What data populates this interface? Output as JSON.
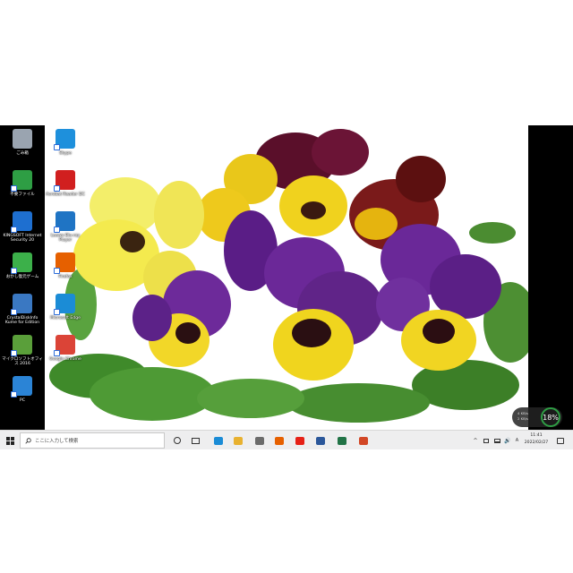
{
  "desktop_icons": [
    {
      "label": "ごみ箱",
      "icon": "recycle-bin-icon",
      "color": "#9aa4b0"
    },
    {
      "label": "不要ファイル",
      "icon": "recycle-green-icon",
      "color": "#2e9e44"
    },
    {
      "label": "KINGSOFT Internet Security 20",
      "icon": "kingsoft-security-icon",
      "color": "#1e6fd0"
    },
    {
      "label": "おかし復元ゲーム",
      "icon": "eye-green-icon",
      "color": "#3cb04a"
    },
    {
      "label": "CrystalDiskInfo Kume for Edition",
      "icon": "crystaldiskinfo-icon",
      "color": "#3a78c2"
    },
    {
      "label": "マイクロソフトオフィス 2016",
      "icon": "office-setup-icon",
      "color": "#5a9f3a"
    },
    {
      "label": "PC",
      "icon": "pc-monitor-icon",
      "color": "#2b84d6"
    },
    {
      "label": "Skype",
      "icon": "skype-icon",
      "color": "#1e90dc"
    },
    {
      "label": "Acrobat Reader DC",
      "icon": "acrobat-reader-icon",
      "color": "#d11f1f"
    },
    {
      "label": "Leawo Blu-ray Player",
      "icon": "bluray-player-icon",
      "color": "#1f74c4"
    },
    {
      "label": "Firefox",
      "icon": "firefox-icon",
      "color": "#e66000"
    },
    {
      "label": "Microsoft Edge",
      "icon": "edge-icon",
      "color": "#1b8cd6"
    },
    {
      "label": "Google Chrome",
      "icon": "chrome-icon",
      "color": "#db4437"
    }
  ],
  "taskbar": {
    "search_placeholder": "ここに入力して検索",
    "apps": [
      {
        "name": "cortana-icon",
        "color": "#333333"
      },
      {
        "name": "task-view-icon",
        "color": "#333333"
      },
      {
        "name": "edge-taskbar-icon",
        "color": "#1b8cd6"
      },
      {
        "name": "file-explorer-icon",
        "color": "#e8b130"
      },
      {
        "name": "mail-icon",
        "color": "#6b6b6b"
      },
      {
        "name": "firefox-taskbar-icon",
        "color": "#e66000"
      },
      {
        "name": "youtube-icon",
        "color": "#e62117"
      },
      {
        "name": "word-icon",
        "color": "#2b579a"
      },
      {
        "name": "excel-icon",
        "color": "#217346"
      },
      {
        "name": "powerpoint-icon",
        "color": "#d24726"
      }
    ],
    "time": "11:41",
    "date": "2022/02/27"
  },
  "widget": {
    "percent": "18%",
    "upload": "4 KB/s",
    "download": "2 KB/s"
  },
  "colors": {
    "taskbar": "#eeeeef",
    "screen_border": "#000000",
    "accent": "#2e9e44"
  }
}
